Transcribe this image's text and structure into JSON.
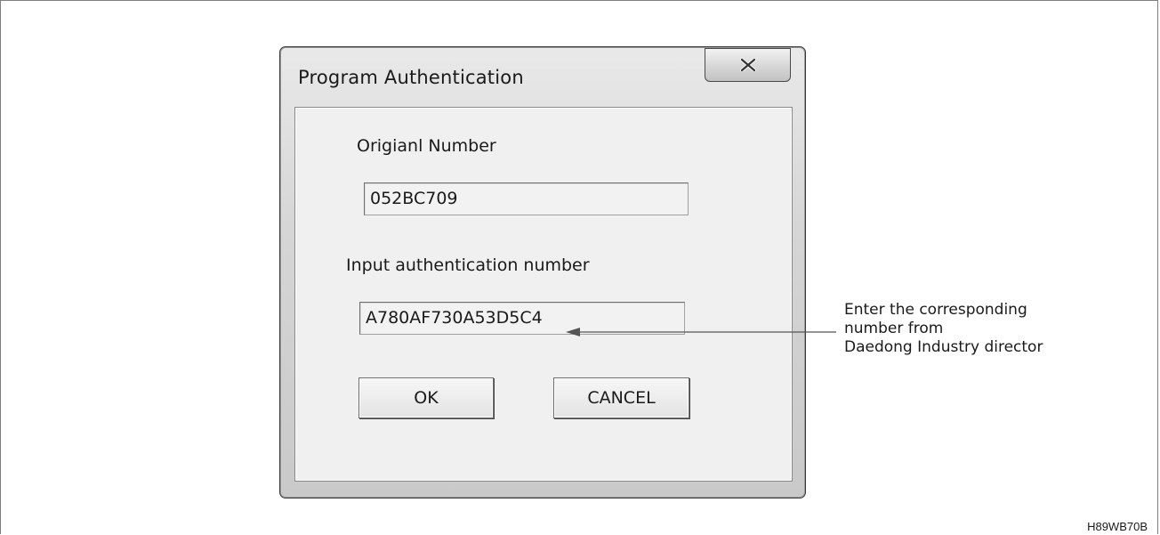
{
  "dialog": {
    "title": "Program Authentication",
    "close_icon": "close-x-icon",
    "original_number_label": "Origianl Number",
    "original_number_value": "052BC709",
    "auth_label": "Input authentication number",
    "auth_value": "A780AF730A53D5C4",
    "ok_label": "OK",
    "cancel_label": "CANCEL"
  },
  "callout": {
    "lines": [
      "Enter the corresponding",
      "number from",
      "Daedong Industry director"
    ],
    "arrow_icon": "arrow-left-icon"
  },
  "figure_code": "H89WB70B"
}
